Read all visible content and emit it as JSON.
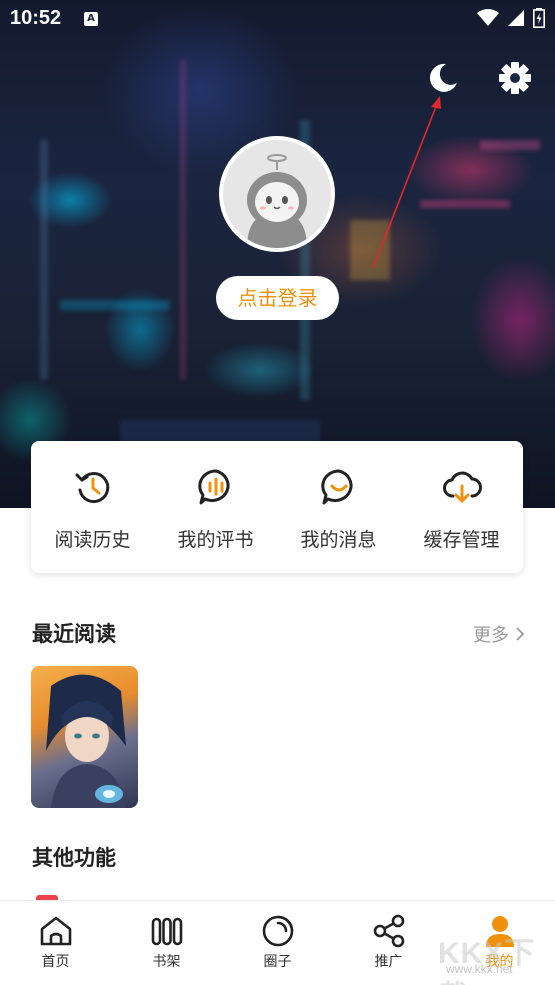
{
  "status_bar": {
    "time": "10:52",
    "notification_icon": "A"
  },
  "header": {
    "night_mode_icon": "moon-icon",
    "settings_icon": "gear-icon",
    "login_label": "点击登录"
  },
  "quick_actions": [
    {
      "icon": "history-icon",
      "label": "阅读历史"
    },
    {
      "icon": "comment-bars-icon",
      "label": "我的评书"
    },
    {
      "icon": "message-icon",
      "label": "我的消息"
    },
    {
      "icon": "cloud-download-icon",
      "label": "缓存管理"
    }
  ],
  "recent_reading": {
    "title": "最近阅读",
    "more_label": "更多"
  },
  "other_functions": {
    "title": "其他功能"
  },
  "bottom_nav": [
    {
      "icon": "home-icon",
      "label": "首页"
    },
    {
      "icon": "bookshelf-icon",
      "label": "书架"
    },
    {
      "icon": "circle-icon",
      "label": "圈子"
    },
    {
      "icon": "share-icon",
      "label": "推广"
    },
    {
      "icon": "person-icon",
      "label": "我的",
      "active": true
    }
  ],
  "watermark": {
    "brand": "KKX下载",
    "url": "www.kkx.net"
  },
  "colors": {
    "accent": "#f0900b",
    "annotation": "#e0282a"
  }
}
